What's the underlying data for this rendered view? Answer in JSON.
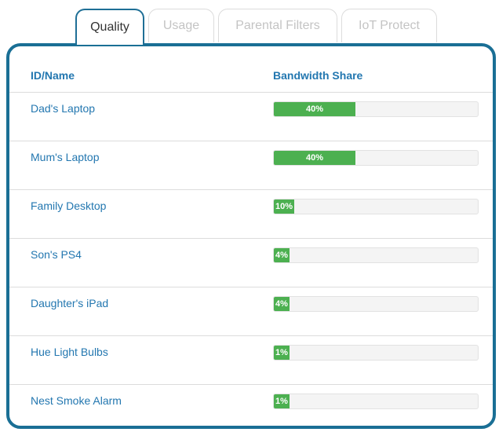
{
  "tabs": [
    {
      "label": "Quality",
      "active": true
    },
    {
      "label": "Usage",
      "active": false
    },
    {
      "label": "Parental Filters",
      "active": false
    },
    {
      "label": "IoT Protect",
      "active": false
    }
  ],
  "table": {
    "headers": {
      "name": "ID/Name",
      "bandwidth": "Bandwidth Share"
    },
    "rows": [
      {
        "name": "Dad's Laptop",
        "share_label": "40%",
        "share": 0.4
      },
      {
        "name": "Mum's Laptop",
        "share_label": "40%",
        "share": 0.4
      },
      {
        "name": "Family Desktop",
        "share_label": "10%",
        "share": 0.1
      },
      {
        "name": "Son's PS4",
        "share_label": "4%",
        "share": 0.04
      },
      {
        "name": "Daughter's iPad",
        "share_label": "4%",
        "share": 0.04
      },
      {
        "name": "Hue Light Bulbs",
        "share_label": "1%",
        "share": 0.01
      },
      {
        "name": "Nest Smoke Alarm",
        "share_label": "1%",
        "share": 0.01
      }
    ]
  },
  "colors": {
    "accent": "#1a6f95",
    "link": "#2377b0",
    "bar": "#4cb050"
  }
}
